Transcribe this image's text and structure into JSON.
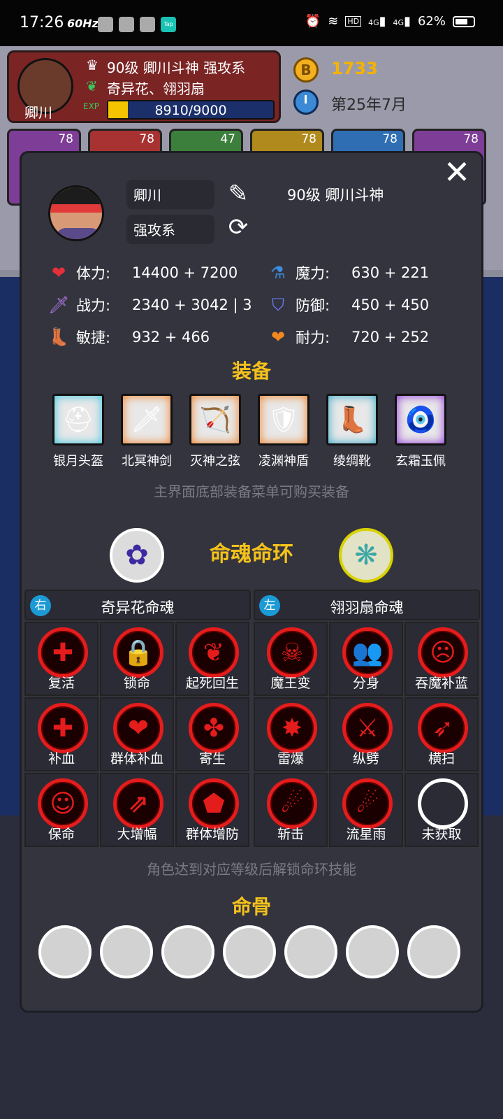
{
  "status_bar": {
    "time": "17:26",
    "refresh": "60Hz",
    "icons": [
      "app-icon-1",
      "app-icon-2",
      "app-icon-3",
      "taptap-icon"
    ],
    "right": {
      "alarm": "alarm-icon",
      "wifi": "wifi-icon",
      "hd": "HD",
      "signal1": "4G",
      "signal2": "4G",
      "battery": "62%"
    }
  },
  "background": {
    "player_name": "卿川",
    "level_line": "90级 卿川斗神 强攻系",
    "soul_line": "奇异花、翎羽扇",
    "exp_icon": "EXP",
    "exp_text": "8910/9000",
    "exp_fraction": 0.99,
    "coins": "1733",
    "date": "第25年7月",
    "hero_tabs": [
      "78",
      "78",
      "47",
      "78",
      "78",
      "78"
    ],
    "hero_colors": [
      "#7e3d97",
      "#a83232",
      "#3c7f3c",
      "#b08a1c",
      "#2f6eb3",
      "#7e3d97"
    ]
  },
  "modal": {
    "close": "✕",
    "name_value": "卿川",
    "class_value": "强攻系",
    "level_title": "90级 卿川斗神",
    "stats": {
      "hp": {
        "label": "体力:",
        "value": "14400 + 7200"
      },
      "mp": {
        "label": "魔力:",
        "value": "630 + 221"
      },
      "atk": {
        "label": "战力:",
        "value": "2340 + 3042 | 3"
      },
      "def": {
        "label": "防御:",
        "value": "450 + 450"
      },
      "agi": {
        "label": "敏捷:",
        "value": "932 + 466"
      },
      "sta": {
        "label": "耐力:",
        "value": "720 + 252"
      }
    },
    "equip_title": "装备",
    "equipment": [
      {
        "name": "银月头盔",
        "icon": "helmet-icon",
        "glyph": "⛑",
        "glow": "#33c3e0"
      },
      {
        "name": "北冥神剑",
        "icon": "sword-icon",
        "glyph": "🗡",
        "glow": "#f07a1a"
      },
      {
        "name": "灭神之弦",
        "icon": "bow-icon",
        "glyph": "🏹",
        "glow": "#f07a1a"
      },
      {
        "name": "凌渊神盾",
        "icon": "shield-icon",
        "glyph": "🛡",
        "glow": "#f07a1a"
      },
      {
        "name": "绫绸靴",
        "icon": "boots-icon",
        "glyph": "👢",
        "glow": "#2aa5c8"
      },
      {
        "name": "玄霜玉佩",
        "icon": "pendant-icon",
        "glyph": "🧿",
        "glow": "#8a2ad6"
      }
    ],
    "equip_hint": "主界面底部装备菜单可购买装备",
    "soul_title": "命魂命环",
    "soul_left_icon": "flower-soul-icon",
    "soul_right_icon": "fan-soul-icon",
    "soul_heads": [
      {
        "tag": "右",
        "title": "奇异花命魂"
      },
      {
        "tag": "左",
        "title": "翎羽扇命魂"
      }
    ],
    "skills": [
      {
        "name": "复活",
        "glyph": "✚",
        "icon": "revive-icon"
      },
      {
        "name": "锁命",
        "glyph": "🔒",
        "icon": "lock-life-icon"
      },
      {
        "name": "起死回生",
        "glyph": "❦",
        "icon": "resurrect-icon"
      },
      {
        "name": "魔王变",
        "glyph": "☠",
        "icon": "demon-king-icon"
      },
      {
        "name": "分身",
        "glyph": "👥",
        "icon": "clone-icon"
      },
      {
        "name": "吞魔补蓝",
        "glyph": "☹",
        "icon": "devour-mana-icon"
      },
      {
        "name": "补血",
        "glyph": "✚",
        "icon": "heal-icon"
      },
      {
        "name": "群体补血",
        "glyph": "❤",
        "icon": "group-heal-icon"
      },
      {
        "name": "寄生",
        "glyph": "✤",
        "icon": "parasite-icon"
      },
      {
        "name": "雷爆",
        "glyph": "✸",
        "icon": "thunder-burst-icon"
      },
      {
        "name": "纵劈",
        "glyph": "⚔",
        "icon": "vertical-slash-icon"
      },
      {
        "name": "横扫",
        "glyph": "➶",
        "icon": "sweep-icon"
      },
      {
        "name": "保命",
        "glyph": "☺",
        "icon": "save-life-icon"
      },
      {
        "name": "大增幅",
        "glyph": "⇗",
        "icon": "amplify-icon"
      },
      {
        "name": "群体增防",
        "glyph": "⬟",
        "icon": "group-defense-icon"
      },
      {
        "name": "斩击",
        "glyph": "☄",
        "icon": "slash-icon"
      },
      {
        "name": "流星雨",
        "glyph": "☄",
        "icon": "meteor-rain-icon"
      },
      {
        "name": "未获取",
        "glyph": "",
        "icon": "empty-slot-icon",
        "empty": true
      }
    ],
    "skill_hint": "角色达到对应等级后解锁命环技能",
    "bone_title": "命骨",
    "bone_slots": 7
  },
  "colors": {
    "accent_gold": "#f4c21b",
    "ring_red": "#e51c1c",
    "panel": "#34343f"
  }
}
